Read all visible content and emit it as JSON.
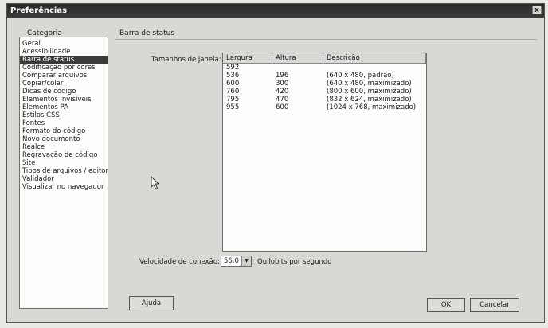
{
  "window": {
    "title": "Preferências",
    "close_label": "x"
  },
  "category": {
    "header": "Categoria",
    "items": [
      "Geral",
      "Acessibilidade",
      "Barra de status",
      "Codificação por cores",
      "Comparar arquivos",
      "Copiar/colar",
      "Dicas de código",
      "Elementos invisíveis",
      "Elementos PA",
      "Estilos CSS",
      "Fontes",
      "Formato do código",
      "Novo documento",
      "Realce",
      "Regravação de código",
      "Site",
      "Tipos de arquivos / editor",
      "Validador",
      "Visualizar no navegador"
    ],
    "selected_index": 2
  },
  "section": {
    "title": "Barra de status"
  },
  "window_sizes": {
    "label": "Tamanhos de janela:",
    "columns": [
      "Largura",
      "Altura",
      "Descrição"
    ],
    "rows": [
      [
        "592",
        "",
        ""
      ],
      [
        "536",
        "196",
        "(640 x 480, padrão)"
      ],
      [
        "600",
        "300",
        "(640 x 480, maximizado)"
      ],
      [
        "760",
        "420",
        "(800 x 600, maximizado)"
      ],
      [
        "795",
        "470",
        "(832 x 624, maximizado)"
      ],
      [
        "955",
        "600",
        "(1024 x 768, maximizado)"
      ]
    ]
  },
  "connection": {
    "label": "Velocidade de conexão:",
    "value": "56.0",
    "unit": "Quilobits por segundo"
  },
  "buttons": {
    "help": "Ajuda",
    "ok": "OK",
    "cancel": "Cancelar"
  }
}
